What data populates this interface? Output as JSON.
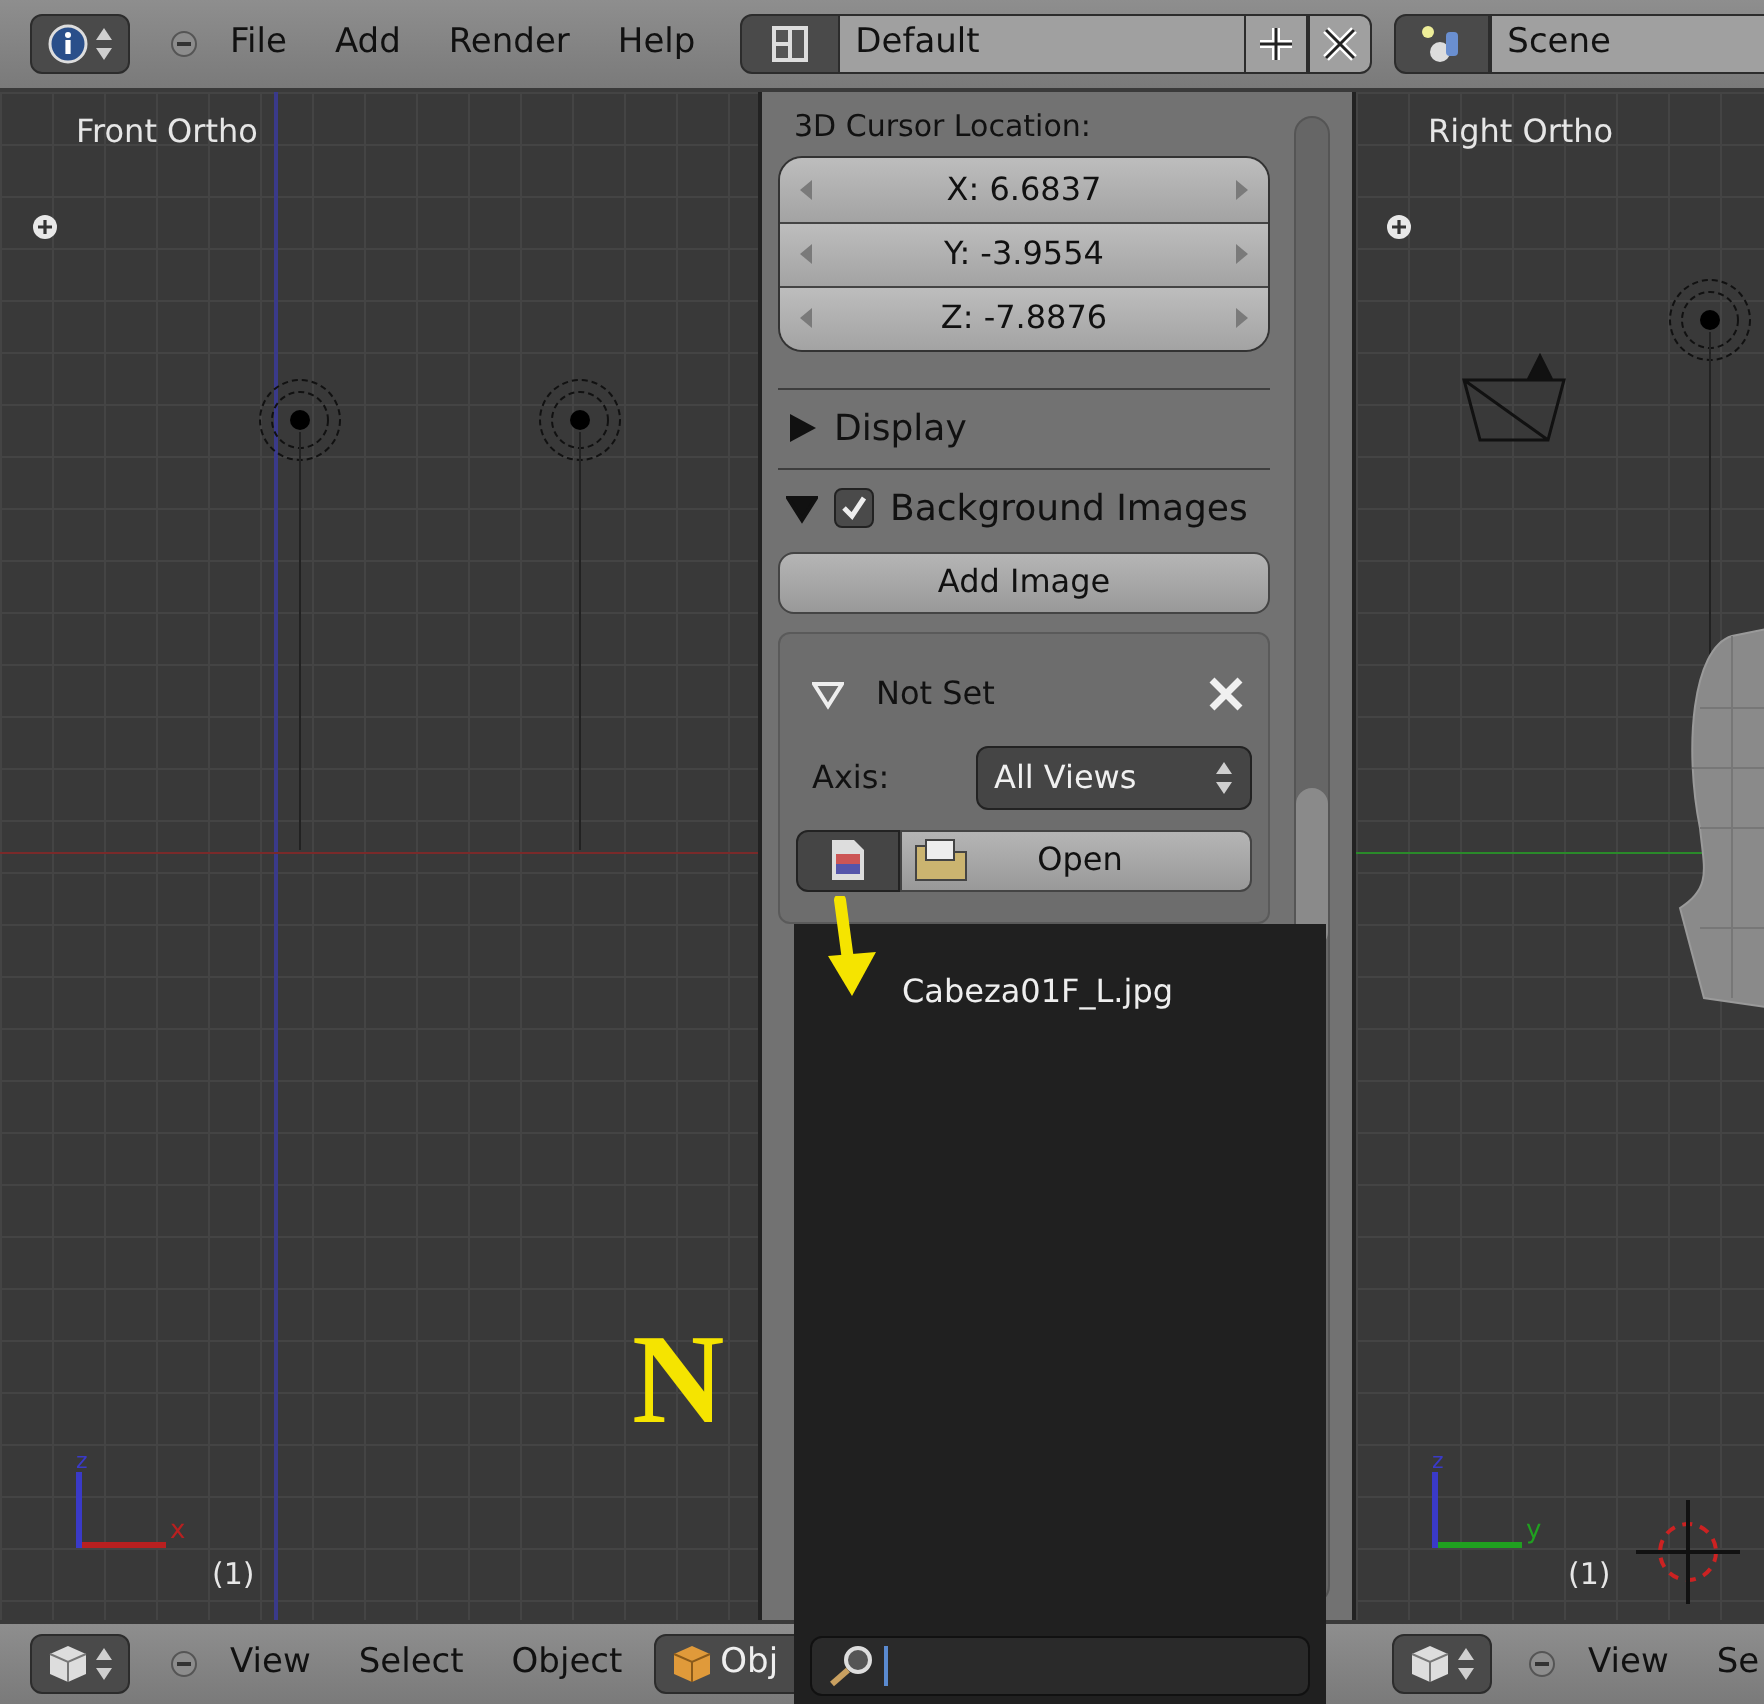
{
  "top_bar": {
    "menus": [
      "File",
      "Add",
      "Render",
      "Help"
    ],
    "screen_layout": "Default",
    "scene": "Scene"
  },
  "left_viewport": {
    "title": "Front Ortho",
    "frame": "(1)",
    "annotation": "N",
    "axes": [
      {
        "label": "z",
        "color": "#3a3ac8"
      },
      {
        "label": "x",
        "color": "#b82020"
      }
    ]
  },
  "properties_panel": {
    "cursor_heading": "3D Cursor Location:",
    "cursor_fields": [
      "X: 6.6837",
      "Y: -3.9554",
      "Z: -7.8876"
    ],
    "sections": [
      {
        "label": "Display",
        "expanded": false
      },
      {
        "label": "Background Images",
        "expanded": true,
        "checked": true
      }
    ],
    "add_button": "Add Image",
    "image_item": {
      "label": "Not Set",
      "expanded": true,
      "axis_label": "Axis:",
      "axis_value": "All Views",
      "open_button": "Open"
    }
  },
  "image_menu": {
    "items": [
      "Cabeza01F_L.jpg"
    ]
  },
  "right_viewport": {
    "title": "Right Ortho",
    "frame": "(1)",
    "axes": [
      {
        "label": "z",
        "color": "#3a3ac8"
      },
      {
        "label": "y",
        "color": "#20a020"
      }
    ]
  },
  "bottom_bar_left": {
    "menus": [
      "View",
      "Select",
      "Object"
    ],
    "mode": "Obj"
  },
  "bottom_bar_right": {
    "menus": [
      "View",
      "Se"
    ]
  }
}
